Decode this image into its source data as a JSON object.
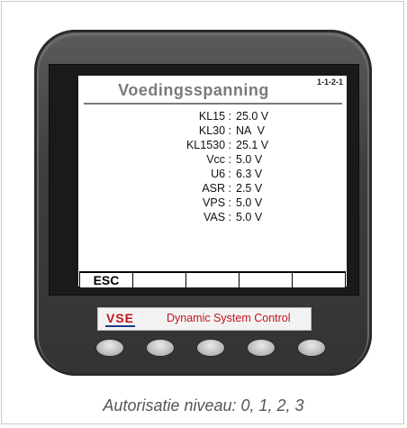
{
  "screen": {
    "title": "Voedingsspanning",
    "code": "1-1-2-1",
    "rows": [
      {
        "label": "KL15 :",
        "value": "25.0 V"
      },
      {
        "label": "KL30 :",
        "value": "NA  V"
      },
      {
        "label": "KL1530 :",
        "value": "25.1 V"
      },
      {
        "label": "Vcc :",
        "value": "5.0 V"
      },
      {
        "label": "U6 :",
        "value": "6.3 V"
      },
      {
        "label": "ASR :",
        "value": "2.5 V"
      },
      {
        "label": "VPS :",
        "value": "5.0 V"
      },
      {
        "label": "VAS :",
        "value": "5.0 V"
      }
    ],
    "function_keys": [
      "ESC",
      "",
      "",
      "",
      ""
    ]
  },
  "brand": {
    "logo": "VSE",
    "text": "Dynamic System Control"
  },
  "caption": "Autorisatie niveau: 0, 1, 2, 3",
  "colors": {
    "brand_red": "#c2141b",
    "brand_blue": "#1a3a8a",
    "device_body": "#3e3e3e"
  }
}
